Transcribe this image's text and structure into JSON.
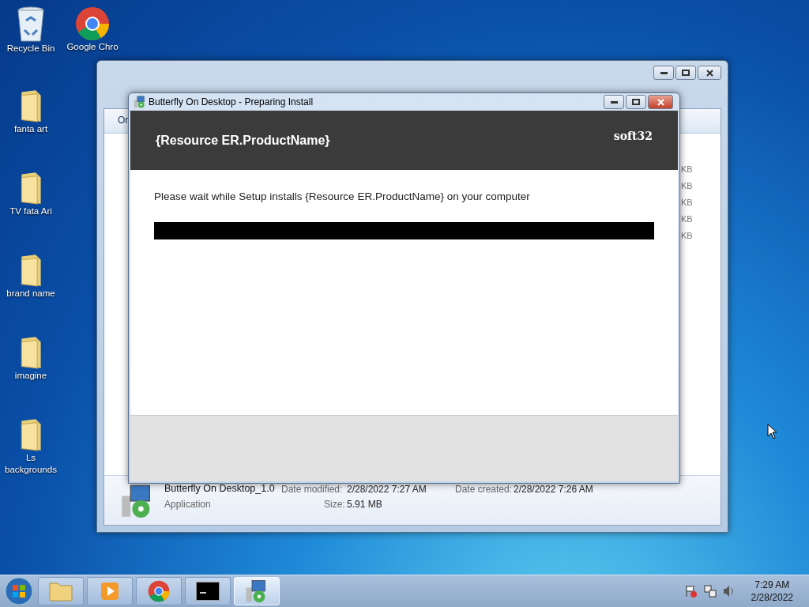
{
  "desktop_icons": [
    {
      "kind": "bin",
      "label": "Recycle Bin"
    },
    {
      "kind": "chrome",
      "label": "Google Chro"
    },
    {
      "kind": "folder",
      "label": "fanta art"
    },
    {
      "kind": "folder",
      "label": "TV  fata Ari"
    },
    {
      "kind": "folder",
      "label": "brand name"
    },
    {
      "kind": "folder",
      "label": "imagine"
    },
    {
      "kind": "folder",
      "label": "Ls backgrounds"
    }
  ],
  "explorer": {
    "toolbar_text": "Or",
    "size_cells": [
      "KB",
      "KB",
      "KB",
      "KB",
      "KB"
    ],
    "details": {
      "name": "Butterfly On Desktop_1.0",
      "type": "Application",
      "fields": [
        {
          "label": "Date modified:",
          "value": "2/28/2022 7:27 AM"
        },
        {
          "label": "Date created:",
          "value": "2/28/2022 7:26 AM"
        },
        {
          "label": "Size:",
          "value": "5.91 MB"
        }
      ]
    }
  },
  "installer": {
    "title": "Butterfly On Desktop - Preparing Install",
    "header": "{Resource ER.ProductName}",
    "logo": "soft32",
    "message": "Please wait while Setup installs {Resource ER.ProductName} on your computer",
    "progress": {
      "level": 1
    }
  },
  "taskbar": {
    "items": [
      {
        "kind": "explorer",
        "selected": false
      },
      {
        "kind": "media",
        "selected": false
      },
      {
        "kind": "chrome",
        "selected": false
      },
      {
        "kind": "cmd",
        "selected": false
      },
      {
        "kind": "installer",
        "selected": true
      }
    ],
    "time": "7:29 AM",
    "date": "2/28/2022"
  }
}
